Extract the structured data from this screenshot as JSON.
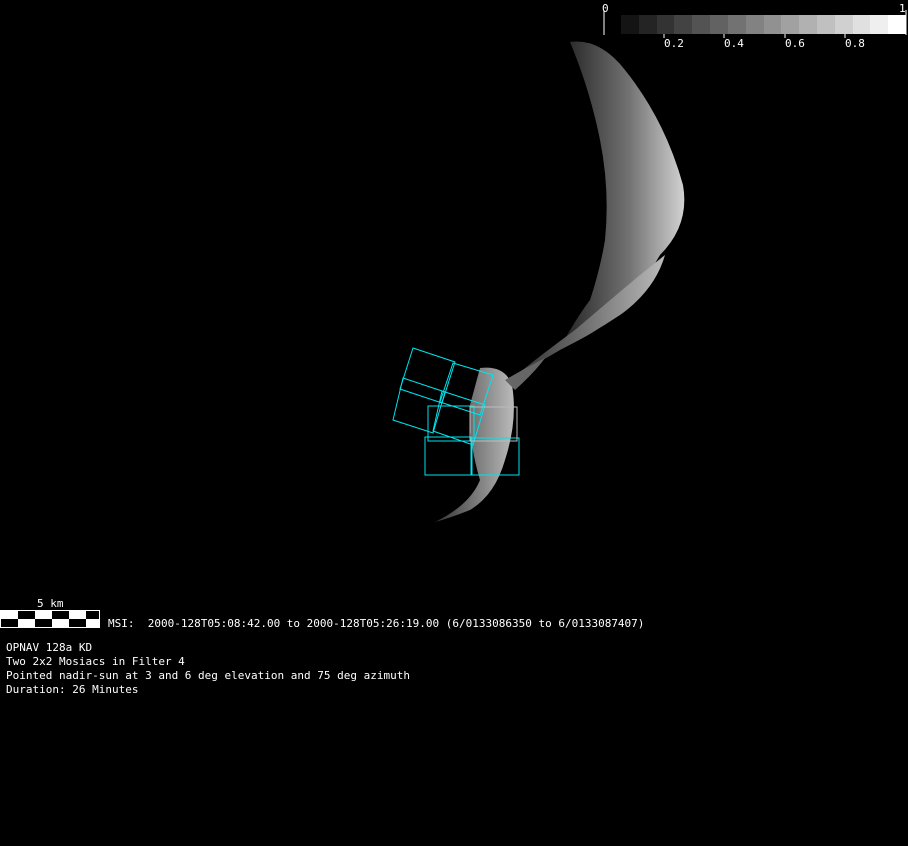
{
  "colorbar": {
    "min_label": "0",
    "max_label": "1",
    "tick_labels": [
      "0.2",
      "0.4",
      "0.6",
      "0.8"
    ],
    "steps": 16
  },
  "scale_bar": {
    "label": "5 km"
  },
  "msi_line": "MSI:  2000-128T05:08:42.00 to 2000-128T05:26:19.00 (6/0133086350 to 6/0133087407)",
  "info": [
    "OPNAV 128a KD",
    "Two 2x2 Mosiacs in Filter 4",
    "Pointed nadir-sun at 3 and 6 deg elevation and 75 deg azimuth",
    "Duration: 26 Minutes"
  ],
  "colors": {
    "footprint": "#00e5ee",
    "background": "#000000"
  }
}
